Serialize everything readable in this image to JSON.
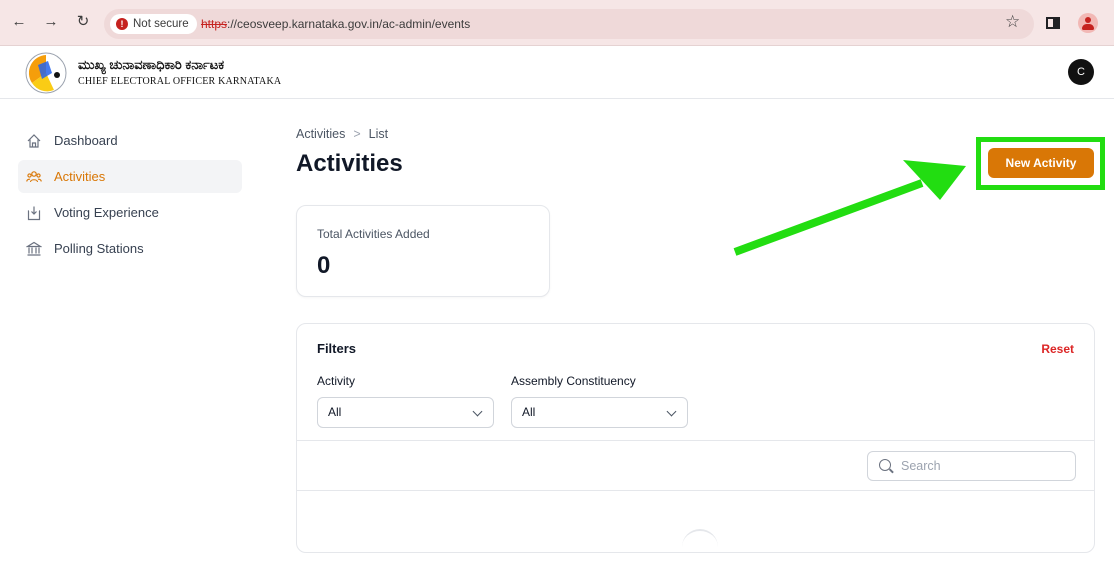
{
  "browser": {
    "security_label": "Not secure",
    "url_scheme": "https",
    "url_rest": "://ceosveep.karnataka.gov.in/ac-admin/events"
  },
  "header": {
    "logo_title_kannada": "ಮುಖ್ಯ ಚುನಾವಣಾಧಿಕಾರಿ ಕರ್ನಾಟಕ",
    "logo_title_english": "CHIEF ELECTORAL OFFICER KARNATAKA",
    "avatar_letter": "C"
  },
  "sidebar": {
    "items": [
      {
        "label": "Dashboard",
        "icon": "home-icon",
        "active": false
      },
      {
        "label": "Activities",
        "icon": "users-icon",
        "active": true
      },
      {
        "label": "Voting Experience",
        "icon": "ballot-icon",
        "active": false
      },
      {
        "label": "Polling Stations",
        "icon": "building-icon",
        "active": false
      }
    ]
  },
  "main": {
    "breadcrumb": [
      "Activities",
      "List"
    ],
    "title": "Activities",
    "new_button_label": "New Activity",
    "stat": {
      "label": "Total Activities Added",
      "value": "0"
    },
    "filters": {
      "title": "Filters",
      "reset_label": "Reset",
      "activity": {
        "label": "Activity",
        "selected": "All"
      },
      "constituency": {
        "label": "Assembly Constituency",
        "selected": "All"
      }
    },
    "search_placeholder": "Search"
  },
  "colors": {
    "accent": "#d97706",
    "highlight": "#22dd11",
    "reset": "#dc2626"
  }
}
